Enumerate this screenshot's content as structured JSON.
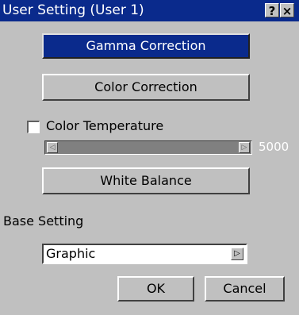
{
  "window": {
    "title": "User Setting (User 1)",
    "help_glyph": "?",
    "close_glyph": "×"
  },
  "buttons": {
    "gamma_correction": "Gamma Correction",
    "color_correction": "Color Correction",
    "white_balance": "White Balance",
    "ok": "OK",
    "cancel": "Cancel"
  },
  "color_temperature": {
    "label": "Color Temperature",
    "checked": false,
    "value": "5000",
    "left_arrow": "◁",
    "right_arrow": "▷"
  },
  "base_setting": {
    "label": "Base Setting",
    "selected": "Graphic",
    "arrow": "▷"
  },
  "colors": {
    "title_bar": "#0a2a8c",
    "dialog_bg": "#c0c0c0",
    "selected_button": "#0a2a8c"
  }
}
